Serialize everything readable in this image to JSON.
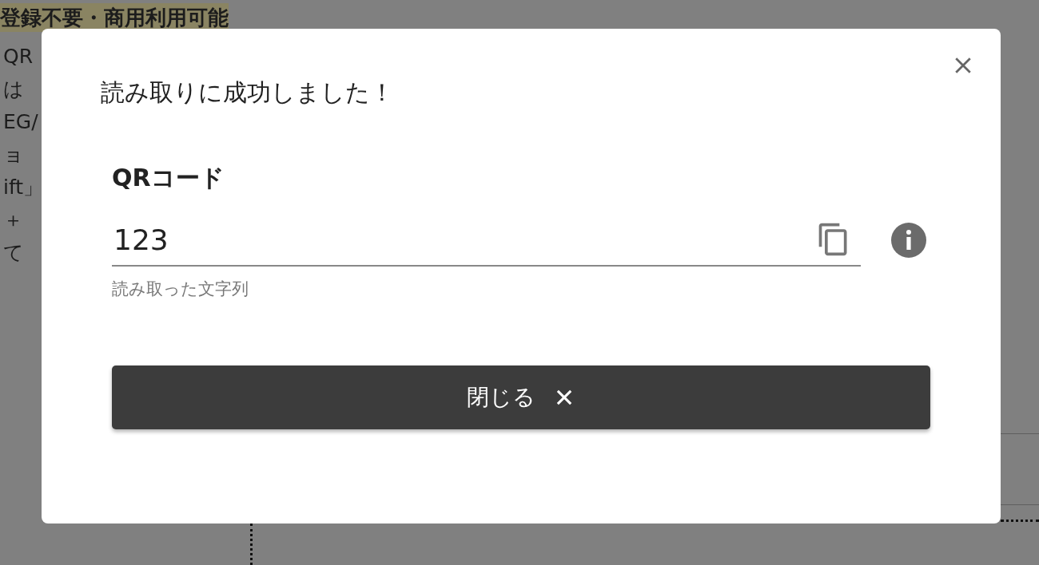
{
  "background": {
    "heading": "登録不要・商用利用可能",
    "lines": [
      "QR",
      "は",
      "EG/",
      "ョ",
      "ift」",
      "＋",
      "て"
    ]
  },
  "dialog": {
    "title": "読み取りに成功しました！",
    "field": {
      "label": "QRコード",
      "value": "123",
      "hint": "読み取った文字列"
    },
    "close_button": {
      "label": "閉じる"
    }
  }
}
